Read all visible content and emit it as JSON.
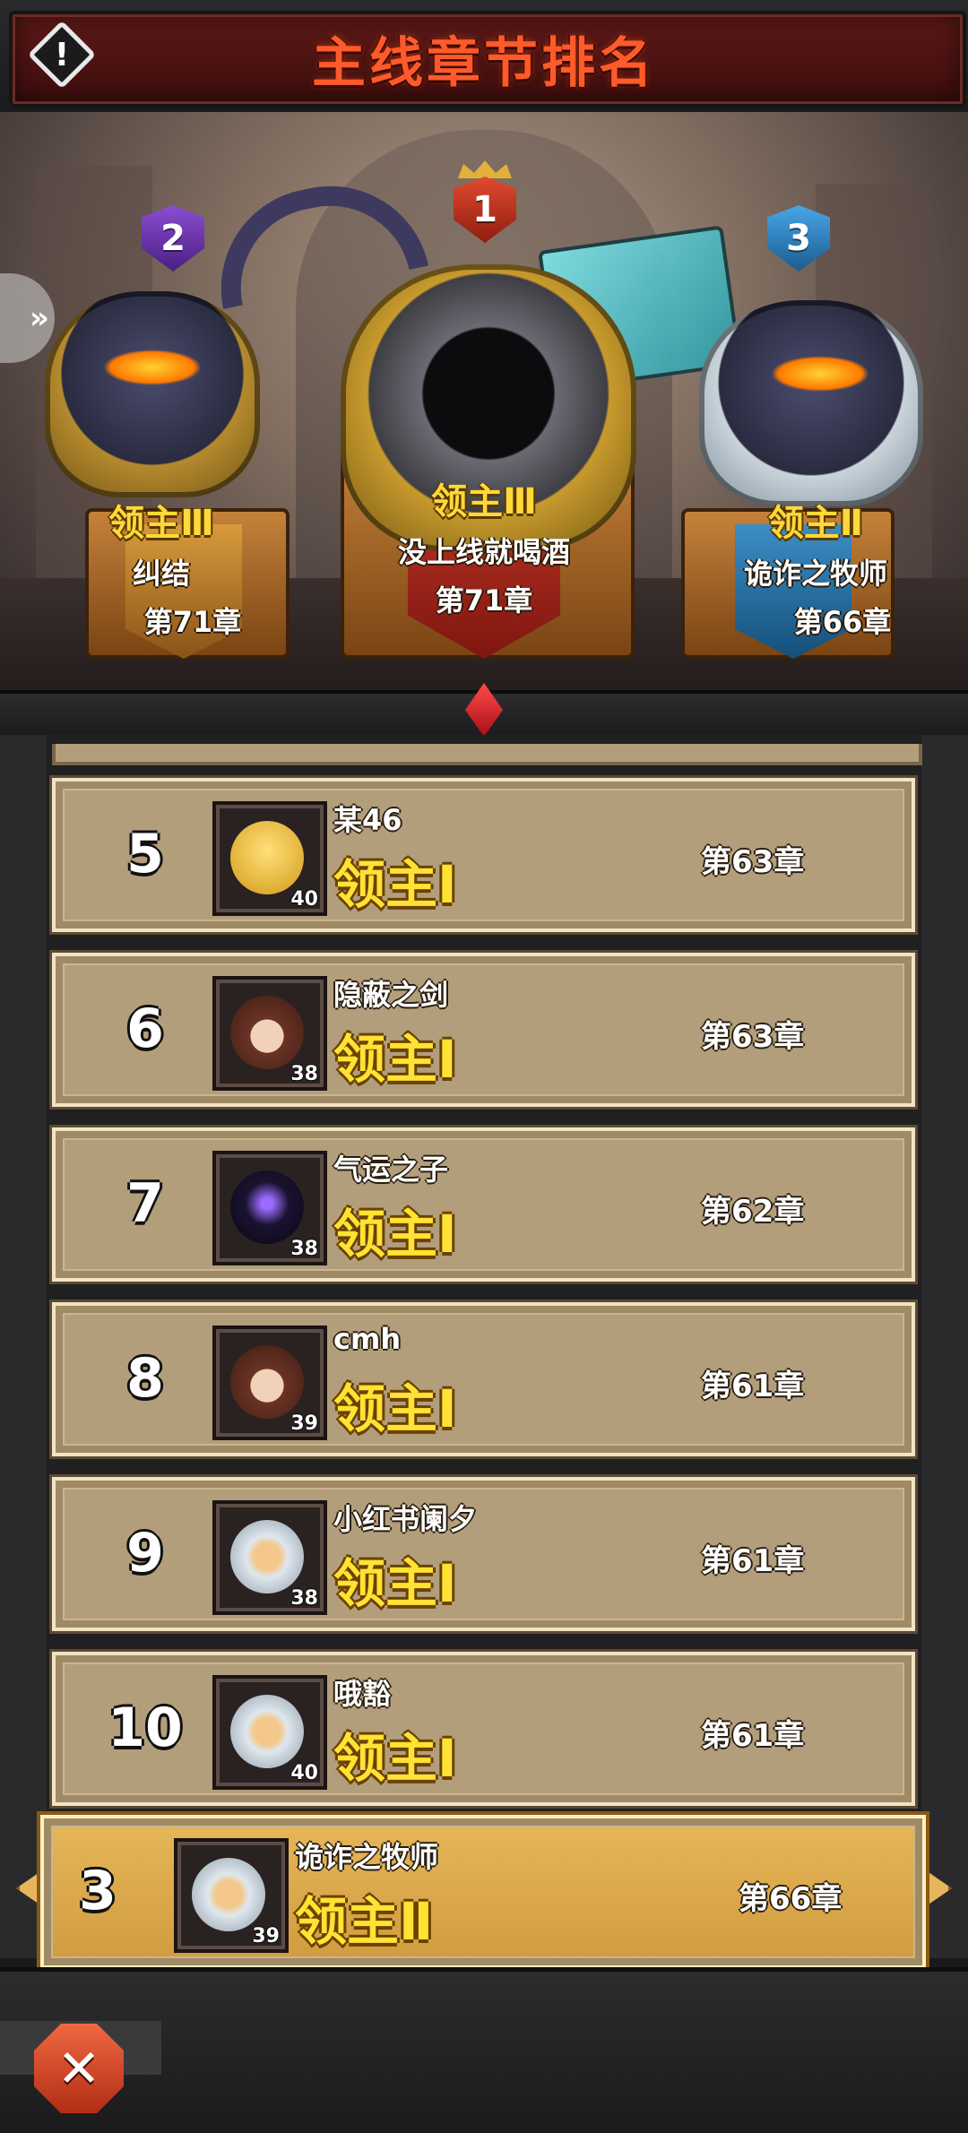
{
  "header": {
    "title": "主线章节排名"
  },
  "podium": [
    {
      "place": "2",
      "tier": "领主Ⅲ",
      "name": "纠结",
      "chapter": "第71章"
    },
    {
      "place": "1",
      "tier": "领主Ⅲ",
      "name": "没上线就喝酒",
      "chapter": "第71章"
    },
    {
      "place": "3",
      "tier": "领主Ⅱ",
      "name": "诡诈之牧师",
      "chapter": "第66章"
    }
  ],
  "rows": [
    {
      "rank": "5",
      "name": "某46",
      "tier": "领主Ⅰ",
      "level": "40",
      "chapter": "第63章"
    },
    {
      "rank": "6",
      "name": "隐蔽之剑",
      "tier": "领主Ⅰ",
      "level": "38",
      "chapter": "第63章"
    },
    {
      "rank": "7",
      "name": "气运之子",
      "tier": "领主Ⅰ",
      "level": "38",
      "chapter": "第62章"
    },
    {
      "rank": "8",
      "name": "cmh",
      "tier": "领主Ⅰ",
      "level": "39",
      "chapter": "第61章"
    },
    {
      "rank": "9",
      "name": "小红书阑夕",
      "tier": "领主Ⅰ",
      "level": "38",
      "chapter": "第61章"
    },
    {
      "rank": "10",
      "name": "哦豁",
      "tier": "领主Ⅰ",
      "level": "40",
      "chapter": "第61章"
    }
  ],
  "my_rank": {
    "rank": "3",
    "name": "诡诈之牧师",
    "tier": "领主Ⅱ",
    "level": "39",
    "chapter": "第66章"
  },
  "icons": {
    "info": "alert-diamond-icon",
    "close": "close-x-icon",
    "side": "double-chevron-right-icon"
  },
  "colors": {
    "title": "#ff5a2a",
    "tier_text": "#ffe233",
    "row_bg": "#b39e7c",
    "my_row_bg": "#e6b75a",
    "rank1": "#e14a2e",
    "rank2": "#8b4dd2",
    "rank3": "#49a6e6"
  }
}
